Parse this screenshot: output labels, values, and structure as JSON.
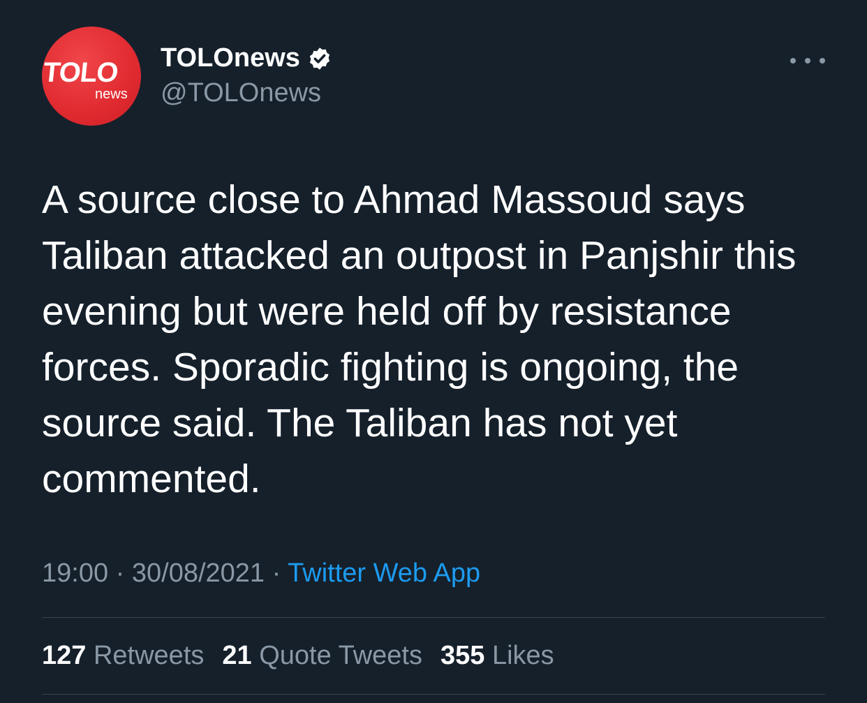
{
  "account": {
    "avatar_text": "TOLO",
    "avatar_subtext": "news",
    "display_name": "TOLOnews",
    "handle": "@TOLOnews",
    "verified": true,
    "avatar_color": "#e02a30"
  },
  "tweet": {
    "text": "A source close to Ahmad Massoud says Taliban attacked an outpost in Panjshir this evening but were held off by resistance forces. Sporadic fighting is ongoing, the source said. The Taliban has not yet commented.",
    "time": "19:00",
    "date": "30/08/2021",
    "separator": "·",
    "source": "Twitter Web App"
  },
  "stats": {
    "retweets_count": "127",
    "retweets_label": "Retweets",
    "quotes_count": "21",
    "quotes_label": "Quote Tweets",
    "likes_count": "355",
    "likes_label": "Likes"
  },
  "colors": {
    "background": "#15202b",
    "text_primary": "#ffffff",
    "text_secondary": "#8b98a5",
    "link": "#1d9bf0",
    "divider": "#38444d"
  },
  "icons": {
    "verified": "verified-badge-icon",
    "more": "more-options-icon"
  }
}
